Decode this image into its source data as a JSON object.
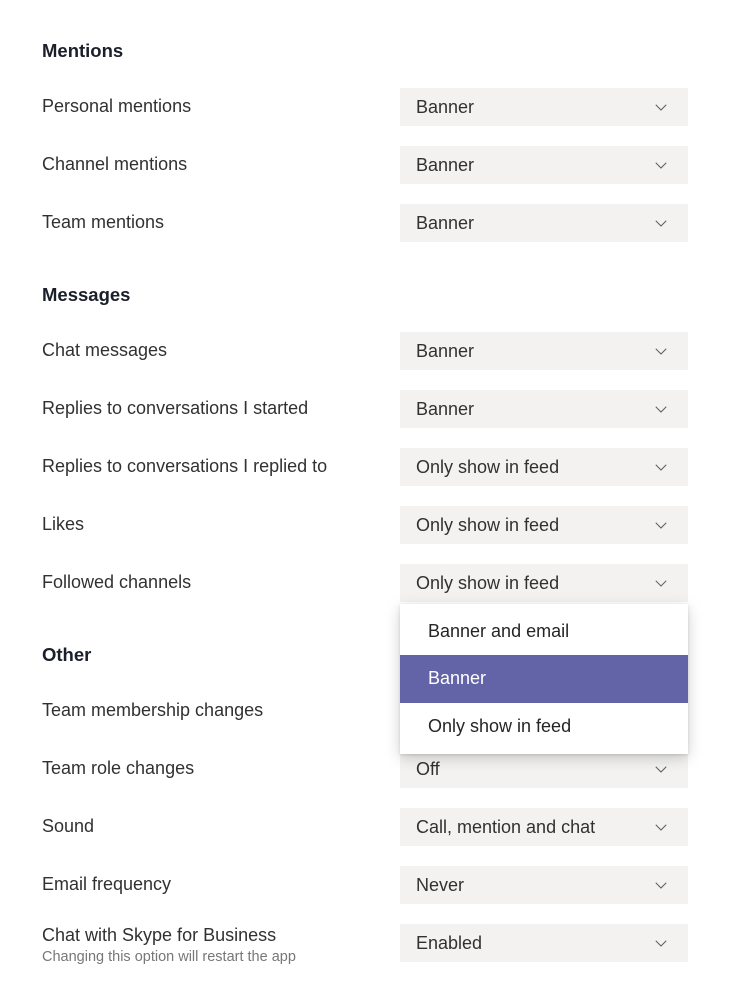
{
  "colors": {
    "accent": "#6264a7",
    "dropdown_bg": "#f3f2f1"
  },
  "sections": {
    "mentions": {
      "title": "Mentions",
      "rows": {
        "personal": {
          "label": "Personal mentions",
          "value": "Banner"
        },
        "channel": {
          "label": "Channel mentions",
          "value": "Banner"
        },
        "team": {
          "label": "Team mentions",
          "value": "Banner"
        }
      }
    },
    "messages": {
      "title": "Messages",
      "rows": {
        "chat": {
          "label": "Chat messages",
          "value": "Banner"
        },
        "replies_started": {
          "label": "Replies to conversations I started",
          "value": "Banner"
        },
        "replies_replied": {
          "label": "Replies to conversations I replied to",
          "value": "Only show in feed"
        },
        "likes": {
          "label": "Likes",
          "value": "Only show in feed"
        },
        "followed": {
          "label": "Followed channels",
          "value": "Only show in feed",
          "open": true,
          "options": [
            "Banner and email",
            "Banner",
            "Only show in feed"
          ],
          "highlighted": "Banner"
        }
      }
    },
    "other": {
      "title": "Other",
      "rows": {
        "membership": {
          "label": "Team membership changes",
          "value": ""
        },
        "role": {
          "label": "Team role changes",
          "value": "Off"
        },
        "sound": {
          "label": "Sound",
          "value": "Call, mention and chat"
        },
        "email_freq": {
          "label": "Email frequency",
          "value": "Never"
        },
        "skype": {
          "label": "Chat with Skype for Business",
          "value": "Enabled",
          "subtext": "Changing this option will restart the app"
        }
      }
    }
  }
}
